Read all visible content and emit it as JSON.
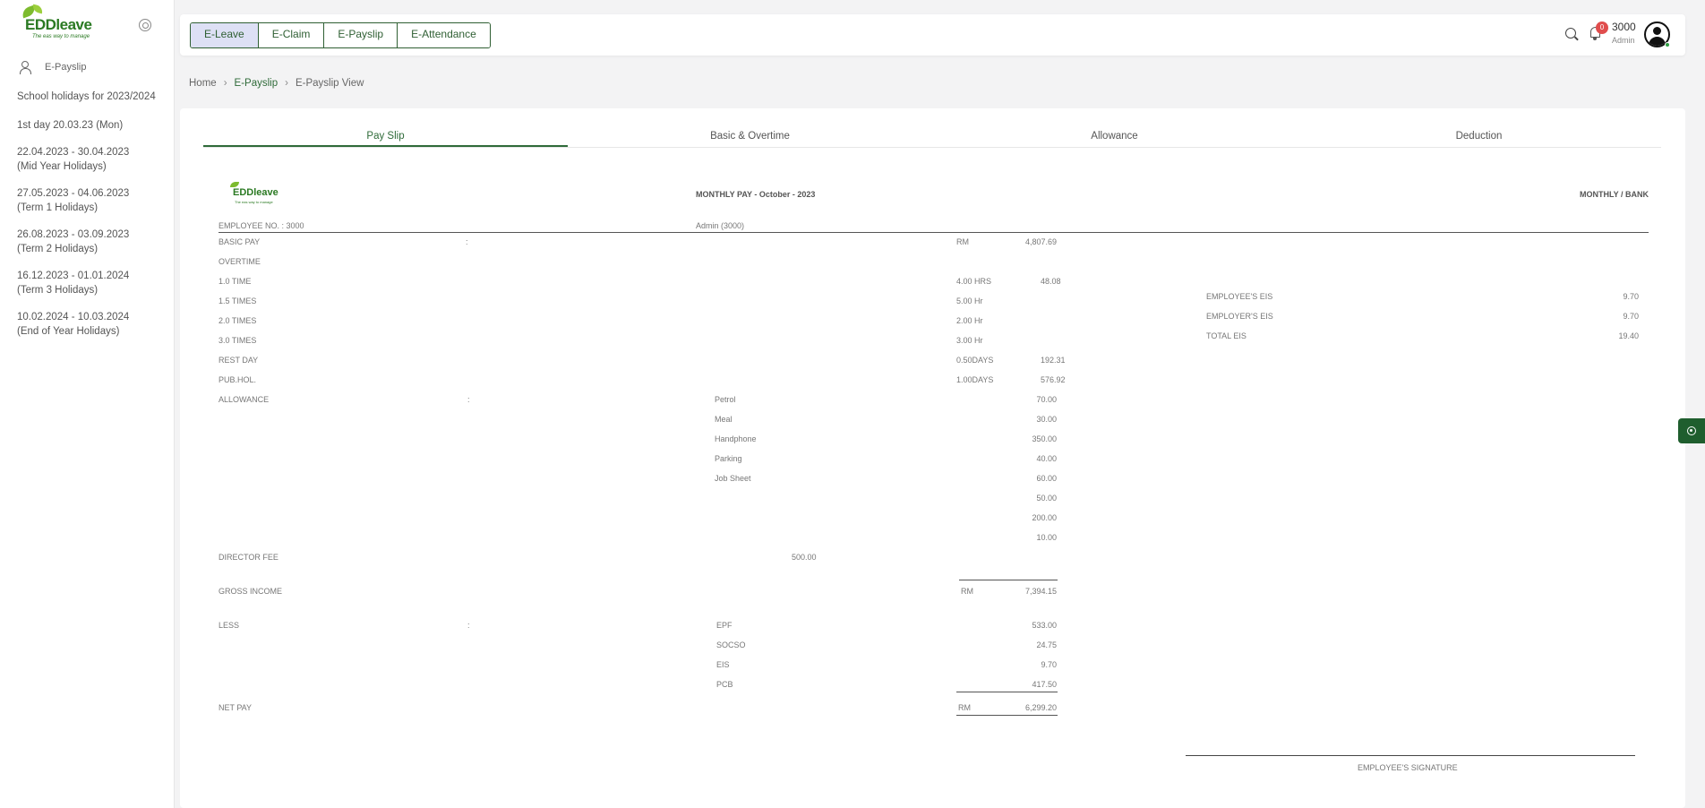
{
  "logo": {
    "word": "EDDleave",
    "tagline": "The eas way to manage"
  },
  "sidebar": {
    "nav_label": "E-Payslip",
    "holidays_title": "School holidays for 2023/2024",
    "holidays": [
      {
        "line1": "1st day 20.03.23 (Mon)",
        "line2": ""
      },
      {
        "line1": "22.04.2023 - 30.04.2023",
        "line2": "(Mid Year Holidays)"
      },
      {
        "line1": "27.05.2023 - 04.06.2023",
        "line2": "(Term 1 Holidays)"
      },
      {
        "line1": "26.08.2023 - 03.09.2023",
        "line2": "(Term 2 Holidays)"
      },
      {
        "line1": "16.12.2023 - 01.01.2024",
        "line2": "(Term 3 Holidays)"
      },
      {
        "line1": "10.02.2024 - 10.03.2024",
        "line2": "(End of Year Holidays)"
      }
    ]
  },
  "modules": [
    "E-Leave",
    "E-Claim",
    "E-Payslip",
    "E-Attendance"
  ],
  "header": {
    "notification_count": "0",
    "user_id": "3000",
    "user_role": "Admin"
  },
  "breadcrumb": [
    "Home",
    "E-Payslip",
    "E-Payslip View"
  ],
  "tabs": [
    "Pay Slip",
    "Basic & Overtime",
    "Allowance",
    "Deduction"
  ],
  "payslip": {
    "title": "MONTHLY PAY - October - 2023",
    "pay_mode": "MONTHLY / BANK",
    "employee_no": "EMPLOYEE NO. : 3000",
    "employee_name": "Admin (3000)",
    "colon": ":",
    "rm": "RM",
    "basic_pay_label": "BASIC PAY",
    "basic_pay_value": "4,807.69",
    "overtime_label": "OVERTIME",
    "overtime_rows": [
      {
        "label": "1.0 TIME",
        "qty": "4.00 HRS",
        "value": "48.08"
      },
      {
        "label": "1.5 TIMES",
        "qty": "5.00 Hr",
        "value": ""
      },
      {
        "label": "2.0 TIMES",
        "qty": "2.00 Hr",
        "value": ""
      },
      {
        "label": "3.0 TIMES",
        "qty": "3.00 Hr",
        "value": ""
      },
      {
        "label": "REST DAY",
        "qty": "0.50DAYS",
        "value": "192.31"
      },
      {
        "label": "PUB.HOL.",
        "qty": "1.00DAYS",
        "value": "576.92"
      }
    ],
    "allowance_label": "ALLOWANCE",
    "allowances": [
      {
        "name": "Petrol",
        "value": "70.00"
      },
      {
        "name": "Meal",
        "value": "30.00"
      },
      {
        "name": "Handphone",
        "value": "350.00"
      },
      {
        "name": "Parking",
        "value": "40.00"
      },
      {
        "name": "Job Sheet",
        "value": "60.00"
      },
      {
        "name": "",
        "value": "50.00"
      },
      {
        "name": "",
        "value": "200.00"
      },
      {
        "name": "",
        "value": "10.00"
      }
    ],
    "director_fee_label": "DIRECTOR FEE",
    "director_fee_value": "500.00",
    "gross_income_label": "GROSS INCOME",
    "gross_income_value": "7,394.15",
    "less_label": "LESS",
    "deductions": [
      {
        "name": "EPF",
        "value": "533.00"
      },
      {
        "name": "SOCSO",
        "value": "24.75"
      },
      {
        "name": "EIS",
        "value": "9.70"
      },
      {
        "name": "PCB",
        "value": "417.50"
      }
    ],
    "net_pay_label": "NET PAY",
    "net_pay_value": "6,299.20",
    "eis_rows": [
      {
        "label": "EMPLOYEE'S EIS",
        "value": "9.70"
      },
      {
        "label": "EMPLOYER'S EIS",
        "value": "9.70"
      },
      {
        "label": "TOTAL EIS",
        "value": "19.40"
      }
    ],
    "signature_label": "EMPLOYEE'S SIGNATURE"
  }
}
